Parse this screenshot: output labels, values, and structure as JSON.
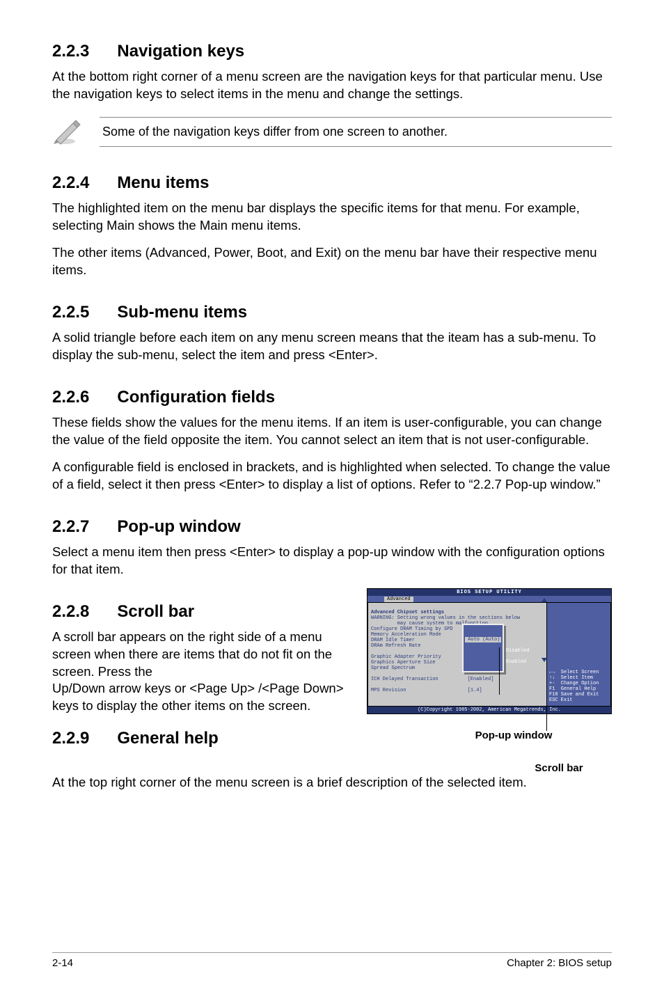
{
  "sec223": {
    "num": "2.2.3",
    "title": "Navigation keys",
    "p1": "At the bottom right corner of a menu screen are the navigation keys for that particular menu. Use the navigation keys to select items in the menu and change the settings.",
    "note": "Some of the navigation keys differ from one screen to another."
  },
  "sec224": {
    "num": "2.2.4",
    "title": "Menu items",
    "p1": "The highlighted item on the menu bar  displays the specific items for that menu. For example, selecting Main shows the Main menu items.",
    "p2": "The other items (Advanced, Power, Boot, and Exit) on the menu bar have their respective menu items."
  },
  "sec225": {
    "num": "2.2.5",
    "title": "Sub-menu items",
    "p1": "A solid triangle before each item on any menu screen means that the iteam has a sub-menu. To display the sub-menu, select the item and press <Enter>."
  },
  "sec226": {
    "num": "2.2.6",
    "title": "Configuration fields",
    "p1": "These fields show the values for the menu items. If an item is user-configurable, you can change the value of the field opposite the item. You cannot select an item that is not user-configurable.",
    "p2": "A configurable field is enclosed in brackets, and is highlighted when selected. To change the value of a field, select it then press <Enter> to display a list of options. Refer to “2.2.7 Pop-up window.”"
  },
  "sec227": {
    "num": "2.2.7",
    "title": "Pop-up window",
    "p1": "Select a menu item then press <Enter> to display a pop-up window with the configuration options for that item."
  },
  "sec228": {
    "num": "2.2.8",
    "title": "Scroll bar",
    "p1": "A scroll bar appears on the right side of a menu screen when there are items that do not fit on the screen. Press the",
    "p2": "Up/Down arrow keys or <Page Up> /<Page Down> keys to display the other items on the screen."
  },
  "sec229": {
    "num": "2.2.9",
    "title": "General help",
    "p1": "At the top right corner of the menu screen is a brief description of the selected item."
  },
  "bios": {
    "title": "BIOS SETUP UTILITY",
    "tab": "Advanced",
    "heading": "Advanced Chipset settings",
    "warning": "WARNING: Setting wrong values in the sections below\n         may cause system to malfunction.",
    "rows": "Configure DRAM Timing by SPD     [Enabled]\nMemory Acceleration Mode         [Auto]\nDRAM Idle Timer                  [Auto]\nDRAm Refresh Rate                [Auto]\n\nGraphic Adapter Priority         [AGP/PCI]\nGraphics Aperture Size           [ 64 MB]\nSpread Spectrum                  [Enabled]\n\nICH Delayed Transaction          [Enabled]\n\nMPS Revision                     [1.4]",
    "help": "←→  Select Screen\n↑↓  Select Item\n+-  Change Option\nF1  General Help\nF10 Save and Exit\nESC Exit",
    "popup_hi": " Auto (Auto) ",
    "popup_dis": "Disabled",
    "popup_en": "Enabled",
    "footer": "(C)Copyright 1985-2002, American Megatrends, Inc."
  },
  "annots": {
    "popup": "Pop-up window",
    "scroll": "Scroll bar"
  },
  "footer": {
    "left": "2-14",
    "right": "Chapter 2: BIOS setup"
  }
}
